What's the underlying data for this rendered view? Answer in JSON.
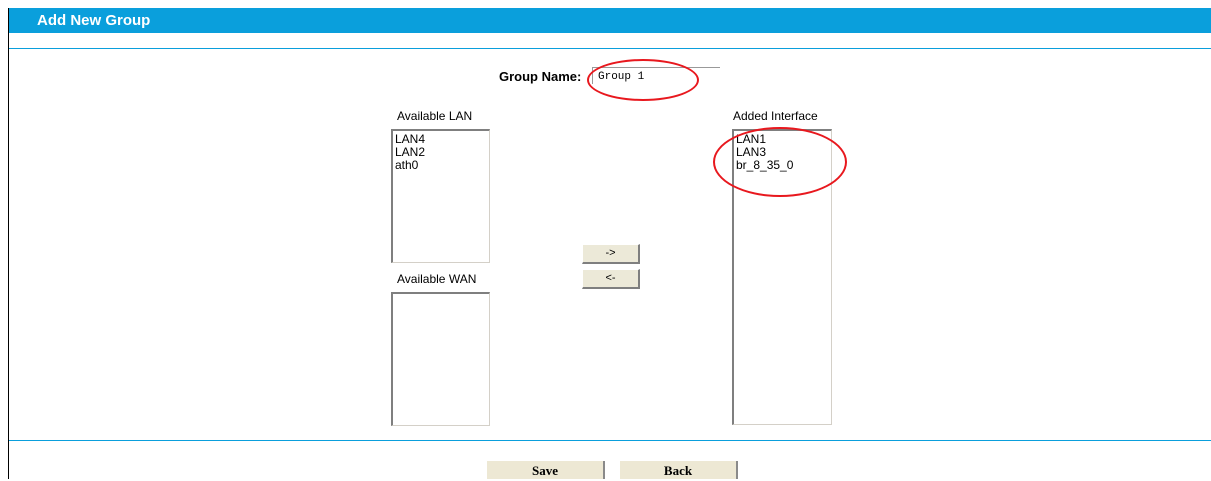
{
  "header": {
    "title": "Add New Group"
  },
  "form": {
    "group_name_label": "Group Name:",
    "group_name_value": "Group 1"
  },
  "available_lan": {
    "label": "Available LAN",
    "items": [
      "LAN4",
      "LAN2",
      "ath0"
    ]
  },
  "available_wan": {
    "label": "Available WAN",
    "items": []
  },
  "added_interface": {
    "label": "Added Interface",
    "items": [
      "LAN1",
      "LAN3",
      "br_8_35_0"
    ]
  },
  "buttons": {
    "add": "->",
    "remove": "<-",
    "save": "Save",
    "back": "Back"
  },
  "colors": {
    "header_bg": "#0a9fdc",
    "annotation": "#e8181e"
  }
}
